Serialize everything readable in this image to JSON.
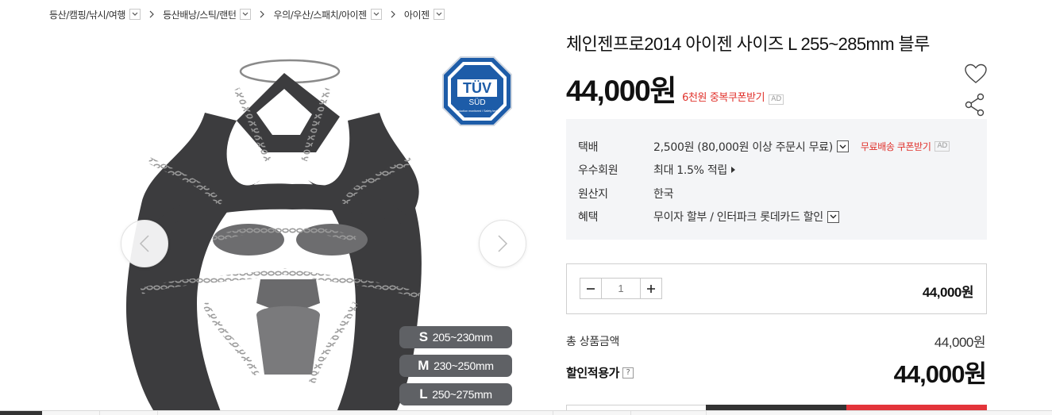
{
  "breadcrumb": [
    {
      "label": "등산/캠핑/낚시/여행"
    },
    {
      "label": "등산배낭/스틱/랜턴"
    },
    {
      "label": "우의/우산/스패치/아이젠"
    },
    {
      "label": "아이젠"
    }
  ],
  "product": {
    "title": "체인젠프로2014 아이젠 사이즈 L 255~285mm 블루",
    "price": "44,000원",
    "coupon_link": "6천원 중복쿠폰받기",
    "ad_tag": "AD",
    "image_badge": {
      "brand": "TÜV",
      "sub": "SÜD",
      "caption": "Production monitored / Safety tested"
    },
    "size_chart": [
      {
        "size": "S",
        "range": "205~230mm"
      },
      {
        "size": "M",
        "range": "230~250mm"
      },
      {
        "size": "L",
        "range": "250~275mm"
      }
    ]
  },
  "info": {
    "shipping_label": "택배",
    "shipping_value": "2,500원 (80,000원 이상 주문시 무료)",
    "free_shipping_coupon": "무료배송 쿠폰받기",
    "ad_tag": "AD",
    "member_label": "우수회원",
    "member_value": "최대 1.5% 적립",
    "origin_label": "원산지",
    "origin_value": "한국",
    "benefit_label": "혜택",
    "benefit_value": "무이자 할부 / 인터파크 롯데카드 할인"
  },
  "quantity": {
    "value": "1",
    "line_price": "44,000원"
  },
  "totals": {
    "total_label": "총 상품금액",
    "total_value": "44,000원",
    "discount_label": "할인적용가",
    "help": "?",
    "discount_value": "44,000원"
  },
  "colors": {
    "accent_red": "#e0312b",
    "dark": "#333333",
    "info_bg": "#f4f5f7"
  }
}
